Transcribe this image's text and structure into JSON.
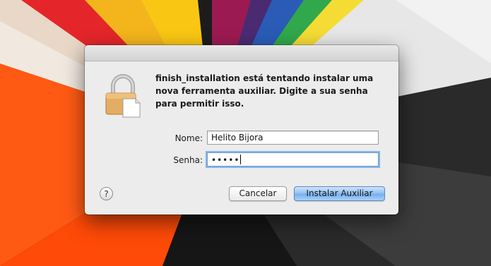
{
  "dialog": {
    "message": [
      "finish_installation está tentando instalar uma",
      "nova ferramenta auxiliar. Digite a sua senha",
      "para permitir isso."
    ],
    "name_label": "Nome:",
    "name_value": "Helito Bijora",
    "password_label": "Senha:",
    "password_masked": "•••••",
    "help_label": "?",
    "cancel_label": "Cancelar",
    "install_label": "Instalar Auxiliar"
  },
  "icons": {
    "lock": "lock-icon",
    "help": "help-icon"
  },
  "colors": {
    "default_button": "#8fbdf2",
    "focus_ring": "#6a9ed9"
  }
}
